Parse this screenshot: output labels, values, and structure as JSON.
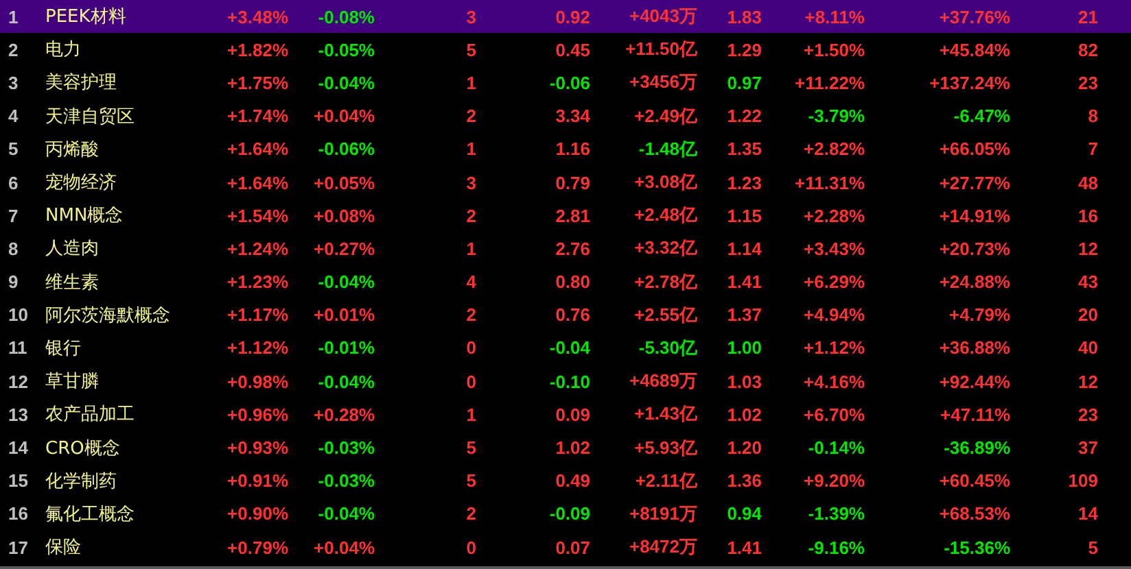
{
  "rows": [
    {
      "rank": "1",
      "name": "PEEK材料",
      "selected": true,
      "cells": [
        {
          "text": "+3.48%",
          "color": "#ff3232"
        },
        {
          "text": "-0.08%",
          "color": "#00e600"
        },
        {
          "text": "3",
          "color": "#ff3232"
        },
        {
          "text": "0.92",
          "color": "#ff3232"
        },
        {
          "text": "+4043万",
          "color": "#ff3232"
        },
        {
          "text": "1.83",
          "color": "#ff3232"
        },
        {
          "text": "+8.11%",
          "color": "#ff3232"
        },
        {
          "text": "+37.76%",
          "color": "#ff3232"
        },
        {
          "text": "21",
          "color": "#ff3232"
        }
      ]
    },
    {
      "rank": "2",
      "name": "电力",
      "selected": false,
      "cells": [
        {
          "text": "+1.82%",
          "color": "#ff3232"
        },
        {
          "text": "-0.05%",
          "color": "#00e600"
        },
        {
          "text": "5",
          "color": "#ff3232"
        },
        {
          "text": "0.45",
          "color": "#ff3232"
        },
        {
          "text": "+11.50亿",
          "color": "#ff3232"
        },
        {
          "text": "1.29",
          "color": "#ff3232"
        },
        {
          "text": "+1.50%",
          "color": "#ff3232"
        },
        {
          "text": "+45.84%",
          "color": "#ff3232"
        },
        {
          "text": "82",
          "color": "#ff3232"
        }
      ]
    },
    {
      "rank": "3",
      "name": "美容护理",
      "selected": false,
      "cells": [
        {
          "text": "+1.75%",
          "color": "#ff3232"
        },
        {
          "text": "-0.04%",
          "color": "#00e600"
        },
        {
          "text": "1",
          "color": "#ff3232"
        },
        {
          "text": "-0.06",
          "color": "#00e600"
        },
        {
          "text": "+3456万",
          "color": "#ff3232"
        },
        {
          "text": "0.97",
          "color": "#00e600"
        },
        {
          "text": "+11.22%",
          "color": "#ff3232"
        },
        {
          "text": "+137.24%",
          "color": "#ff3232"
        },
        {
          "text": "23",
          "color": "#ff3232"
        }
      ]
    },
    {
      "rank": "4",
      "name": "天津自贸区",
      "selected": false,
      "cells": [
        {
          "text": "+1.74%",
          "color": "#ff3232"
        },
        {
          "text": "+0.04%",
          "color": "#ff3232"
        },
        {
          "text": "2",
          "color": "#ff3232"
        },
        {
          "text": "3.34",
          "color": "#ff3232"
        },
        {
          "text": "+2.49亿",
          "color": "#ff3232"
        },
        {
          "text": "1.22",
          "color": "#ff3232"
        },
        {
          "text": "-3.79%",
          "color": "#00e600"
        },
        {
          "text": "-6.47%",
          "color": "#00e600"
        },
        {
          "text": "8",
          "color": "#ff3232"
        }
      ]
    },
    {
      "rank": "5",
      "name": "丙烯酸",
      "selected": false,
      "cells": [
        {
          "text": "+1.64%",
          "color": "#ff3232"
        },
        {
          "text": "-0.06%",
          "color": "#00e600"
        },
        {
          "text": "1",
          "color": "#ff3232"
        },
        {
          "text": "1.16",
          "color": "#ff3232"
        },
        {
          "text": "-1.48亿",
          "color": "#00e600"
        },
        {
          "text": "1.35",
          "color": "#ff3232"
        },
        {
          "text": "+2.82%",
          "color": "#ff3232"
        },
        {
          "text": "+66.05%",
          "color": "#ff3232"
        },
        {
          "text": "7",
          "color": "#ff3232"
        }
      ]
    },
    {
      "rank": "6",
      "name": "宠物经济",
      "selected": false,
      "cells": [
        {
          "text": "+1.64%",
          "color": "#ff3232"
        },
        {
          "text": "+0.05%",
          "color": "#ff3232"
        },
        {
          "text": "3",
          "color": "#ff3232"
        },
        {
          "text": "0.79",
          "color": "#ff3232"
        },
        {
          "text": "+3.08亿",
          "color": "#ff3232"
        },
        {
          "text": "1.23",
          "color": "#ff3232"
        },
        {
          "text": "+11.31%",
          "color": "#ff3232"
        },
        {
          "text": "+27.77%",
          "color": "#ff3232"
        },
        {
          "text": "48",
          "color": "#ff3232"
        }
      ]
    },
    {
      "rank": "7",
      "name": "NMN概念",
      "selected": false,
      "cells": [
        {
          "text": "+1.54%",
          "color": "#ff3232"
        },
        {
          "text": "+0.08%",
          "color": "#ff3232"
        },
        {
          "text": "2",
          "color": "#ff3232"
        },
        {
          "text": "2.81",
          "color": "#ff3232"
        },
        {
          "text": "+2.48亿",
          "color": "#ff3232"
        },
        {
          "text": "1.15",
          "color": "#ff3232"
        },
        {
          "text": "+2.28%",
          "color": "#ff3232"
        },
        {
          "text": "+14.91%",
          "color": "#ff3232"
        },
        {
          "text": "16",
          "color": "#ff3232"
        }
      ]
    },
    {
      "rank": "8",
      "name": "人造肉",
      "selected": false,
      "cells": [
        {
          "text": "+1.24%",
          "color": "#ff3232"
        },
        {
          "text": "+0.27%",
          "color": "#ff3232"
        },
        {
          "text": "1",
          "color": "#ff3232"
        },
        {
          "text": "2.76",
          "color": "#ff3232"
        },
        {
          "text": "+3.32亿",
          "color": "#ff3232"
        },
        {
          "text": "1.14",
          "color": "#ff3232"
        },
        {
          "text": "+3.43%",
          "color": "#ff3232"
        },
        {
          "text": "+20.73%",
          "color": "#ff3232"
        },
        {
          "text": "12",
          "color": "#ff3232"
        }
      ]
    },
    {
      "rank": "9",
      "name": "维生素",
      "selected": false,
      "cells": [
        {
          "text": "+1.23%",
          "color": "#ff3232"
        },
        {
          "text": "-0.04%",
          "color": "#00e600"
        },
        {
          "text": "4",
          "color": "#ff3232"
        },
        {
          "text": "0.80",
          "color": "#ff3232"
        },
        {
          "text": "+2.78亿",
          "color": "#ff3232"
        },
        {
          "text": "1.41",
          "color": "#ff3232"
        },
        {
          "text": "+6.29%",
          "color": "#ff3232"
        },
        {
          "text": "+24.88%",
          "color": "#ff3232"
        },
        {
          "text": "43",
          "color": "#ff3232"
        }
      ]
    },
    {
      "rank": "10",
      "name": "阿尔茨海默概念",
      "selected": false,
      "cells": [
        {
          "text": "+1.17%",
          "color": "#ff3232"
        },
        {
          "text": "+0.01%",
          "color": "#ff3232"
        },
        {
          "text": "2",
          "color": "#ff3232"
        },
        {
          "text": "0.76",
          "color": "#ff3232"
        },
        {
          "text": "+2.55亿",
          "color": "#ff3232"
        },
        {
          "text": "1.37",
          "color": "#ff3232"
        },
        {
          "text": "+4.94%",
          "color": "#ff3232"
        },
        {
          "text": "+4.79%",
          "color": "#ff3232"
        },
        {
          "text": "20",
          "color": "#ff3232"
        }
      ]
    },
    {
      "rank": "11",
      "name": "银行",
      "selected": false,
      "cells": [
        {
          "text": "+1.12%",
          "color": "#ff3232"
        },
        {
          "text": "-0.01%",
          "color": "#00e600"
        },
        {
          "text": "0",
          "color": "#ff3232"
        },
        {
          "text": "-0.04",
          "color": "#00e600"
        },
        {
          "text": "-5.30亿",
          "color": "#00e600"
        },
        {
          "text": "1.00",
          "color": "#00e600"
        },
        {
          "text": "+1.12%",
          "color": "#ff3232"
        },
        {
          "text": "+36.88%",
          "color": "#ff3232"
        },
        {
          "text": "40",
          "color": "#ff3232"
        }
      ]
    },
    {
      "rank": "12",
      "name": "草甘膦",
      "selected": false,
      "cells": [
        {
          "text": "+0.98%",
          "color": "#ff3232"
        },
        {
          "text": "-0.04%",
          "color": "#00e600"
        },
        {
          "text": "0",
          "color": "#ff3232"
        },
        {
          "text": "-0.10",
          "color": "#00e600"
        },
        {
          "text": "+4689万",
          "color": "#ff3232"
        },
        {
          "text": "1.03",
          "color": "#ff3232"
        },
        {
          "text": "+4.16%",
          "color": "#ff3232"
        },
        {
          "text": "+92.44%",
          "color": "#ff3232"
        },
        {
          "text": "12",
          "color": "#ff3232"
        }
      ]
    },
    {
      "rank": "13",
      "name": "农产品加工",
      "selected": false,
      "cells": [
        {
          "text": "+0.96%",
          "color": "#ff3232"
        },
        {
          "text": "+0.28%",
          "color": "#ff3232"
        },
        {
          "text": "1",
          "color": "#ff3232"
        },
        {
          "text": "0.09",
          "color": "#ff3232"
        },
        {
          "text": "+1.43亿",
          "color": "#ff3232"
        },
        {
          "text": "1.02",
          "color": "#ff3232"
        },
        {
          "text": "+6.70%",
          "color": "#ff3232"
        },
        {
          "text": "+47.11%",
          "color": "#ff3232"
        },
        {
          "text": "23",
          "color": "#ff3232"
        }
      ]
    },
    {
      "rank": "14",
      "name": "CRO概念",
      "selected": false,
      "cells": [
        {
          "text": "+0.93%",
          "color": "#ff3232"
        },
        {
          "text": "-0.03%",
          "color": "#00e600"
        },
        {
          "text": "5",
          "color": "#ff3232"
        },
        {
          "text": "1.02",
          "color": "#ff3232"
        },
        {
          "text": "+5.93亿",
          "color": "#ff3232"
        },
        {
          "text": "1.20",
          "color": "#ff3232"
        },
        {
          "text": "-0.14%",
          "color": "#00e600"
        },
        {
          "text": "-36.89%",
          "color": "#00e600"
        },
        {
          "text": "37",
          "color": "#ff3232"
        }
      ]
    },
    {
      "rank": "15",
      "name": "化学制药",
      "selected": false,
      "cells": [
        {
          "text": "+0.91%",
          "color": "#ff3232"
        },
        {
          "text": "-0.03%",
          "color": "#00e600"
        },
        {
          "text": "5",
          "color": "#ff3232"
        },
        {
          "text": "0.49",
          "color": "#ff3232"
        },
        {
          "text": "+2.11亿",
          "color": "#ff3232"
        },
        {
          "text": "1.36",
          "color": "#ff3232"
        },
        {
          "text": "+9.20%",
          "color": "#ff3232"
        },
        {
          "text": "+60.45%",
          "color": "#ff3232"
        },
        {
          "text": "109",
          "color": "#ff3232"
        }
      ]
    },
    {
      "rank": "16",
      "name": "氟化工概念",
      "selected": false,
      "cells": [
        {
          "text": "+0.90%",
          "color": "#ff3232"
        },
        {
          "text": "-0.04%",
          "color": "#00e600"
        },
        {
          "text": "2",
          "color": "#ff3232"
        },
        {
          "text": "-0.09",
          "color": "#00e600"
        },
        {
          "text": "+8191万",
          "color": "#ff3232"
        },
        {
          "text": "0.94",
          "color": "#00e600"
        },
        {
          "text": "-1.39%",
          "color": "#00e600"
        },
        {
          "text": "+68.53%",
          "color": "#ff3232"
        },
        {
          "text": "14",
          "color": "#ff3232"
        }
      ]
    },
    {
      "rank": "17",
      "name": "保险",
      "selected": false,
      "cells": [
        {
          "text": "+0.79%",
          "color": "#ff3232"
        },
        {
          "text": "+0.04%",
          "color": "#ff3232"
        },
        {
          "text": "0",
          "color": "#ff3232"
        },
        {
          "text": "0.07",
          "color": "#ff3232"
        },
        {
          "text": "+8472万",
          "color": "#ff3232"
        },
        {
          "text": "1.41",
          "color": "#ff3232"
        },
        {
          "text": "-9.16%",
          "color": "#00e600"
        },
        {
          "text": "-15.36%",
          "color": "#00e600"
        },
        {
          "text": "5",
          "color": "#ff3232"
        }
      ]
    }
  ]
}
